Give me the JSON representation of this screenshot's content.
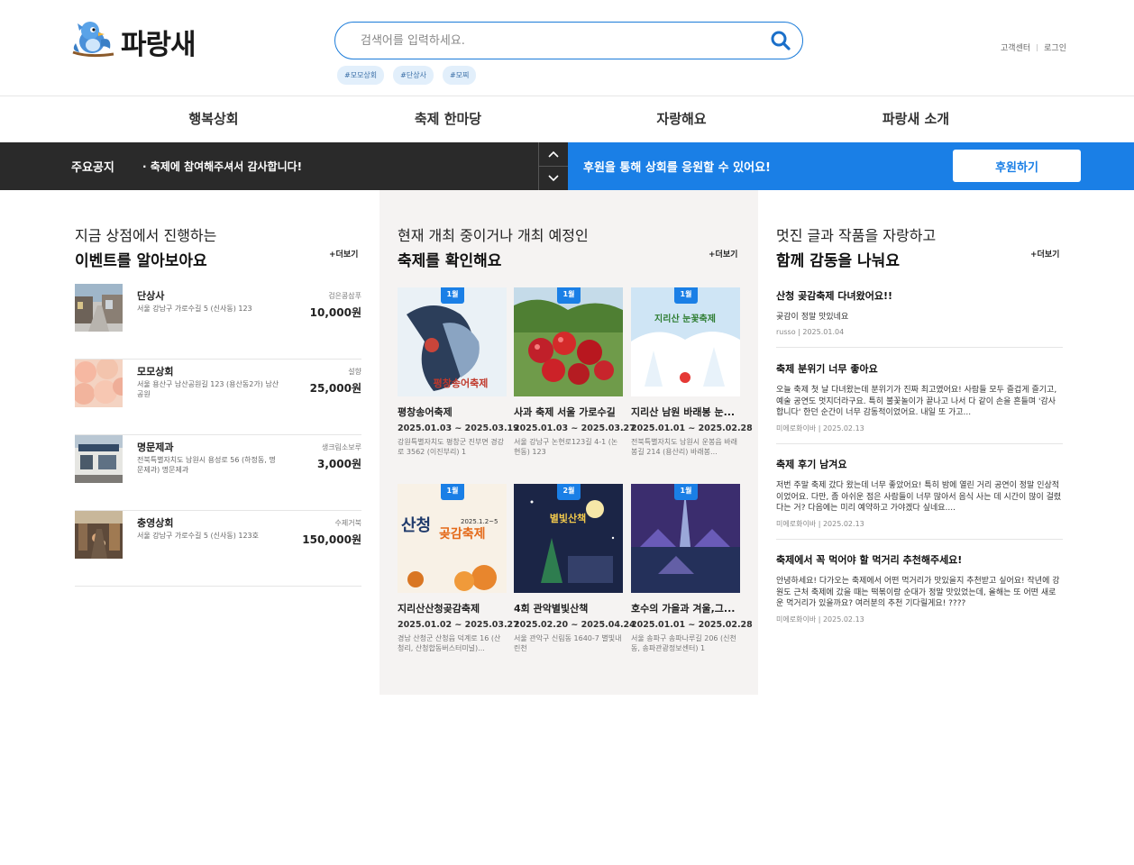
{
  "brand": {
    "name": "파랑새"
  },
  "search": {
    "placeholder": "검색어를 입력하세요.",
    "tags": [
      "#모모상회",
      "#단상사",
      "#모찌"
    ]
  },
  "util": {
    "support": "고객센터",
    "login": "로그인"
  },
  "nav": [
    "행복상회",
    "축제 한마당",
    "자랑해요",
    "파랑새 소개"
  ],
  "notice": {
    "label": "주요공지",
    "text": "· 축제에 참여해주셔서 감사합니다!"
  },
  "support_banner": {
    "text": "후원을 통해 상회를 응원할 수 있어요!",
    "button": "후원하기"
  },
  "events": {
    "line1": "지금 상점에서 진행하는",
    "line2": "이벤트를 알아보아요",
    "more": "+더보기",
    "items": [
      {
        "name": "단상사",
        "address": "서울 강남구 가로수길 5 (신사동) 123",
        "category": "검은콩삼푸",
        "price": "10,000원"
      },
      {
        "name": "모모상회",
        "address": "서울 용산구 남산공원길 123 (용산동2가) 남산공원",
        "category": "설향",
        "price": "25,000원"
      },
      {
        "name": "명문제과",
        "address": "전북특별자치도 남원시 용성로 56 (하정동, 명문제과) 명문제과",
        "category": "생크림소보루",
        "price": "3,000원"
      },
      {
        "name": "충영상회",
        "address": "서울 강남구 가로수길 5 (신사동) 123호",
        "category": "수제거북",
        "price": "150,000원"
      }
    ]
  },
  "festivals": {
    "line1": "현재 개최 중이거나 개최 예정인",
    "line2": "축제를 확인해요",
    "more": "+더보기",
    "items": [
      {
        "month": "1월",
        "title": "평창송어축제",
        "date": "2025.01.03 ~ 2025.03.19",
        "location": "강원특별자치도 평창군 진부면 경강로 3562 (이진부리) 1"
      },
      {
        "month": "1월",
        "title": "사과 축제 서울 가로수길",
        "date": "2025.01.03 ~ 2025.03.27",
        "location": "서울 강남구 논현로123길 4-1 (논현동) 123"
      },
      {
        "month": "1월",
        "title": "지리산 남원 바래봉 눈...",
        "date": "2025.01.01 ~ 2025.02.28",
        "location": "전북특별자치도 남원시 운봉읍 바래봉길 214 (용산리) 바래봉..."
      },
      {
        "month": "1월",
        "title": "지리산산청곶감축제",
        "date": "2025.01.02 ~ 2025.03.27",
        "location": "경남 산청군 산청읍 덕계로 16 (산청리, 산청합동버스터미널)..."
      },
      {
        "month": "2월",
        "title": "4회 관악별빛산책",
        "date": "2025.02.20 ~ 2025.04.24",
        "location": "서울 관악구 신림동 1640-7 별빛내린천"
      },
      {
        "month": "1월",
        "title": "호수의 가을과 겨울,그...",
        "date": "2025.01.01 ~ 2025.02.28",
        "location": "서울 송파구 송파나루길 206 (신천동, 송파관광정보센터) 1"
      }
    ],
    "poster_texts": {
      "p1": "평창송어축제",
      "p3": "지리산 눈꽃축제",
      "p4a": "산청",
      "p4b": "곶감축제",
      "p4c": "2025.1.2~5",
      "p5": "별빛산책"
    }
  },
  "posts": {
    "line1": "멋진 글과 작품을 자랑하고",
    "line2": "함께 감동을 나눠요",
    "more": "+더보기",
    "items": [
      {
        "title": "산청 곶감축제 다녀왔어요!!",
        "body": "곶감이 정말 맛있네요",
        "meta": "russo | 2025.01.04"
      },
      {
        "title": "축제 분위기 너무 좋아요",
        "body": "오늘 축제 첫 날 다녀왔는데 분위기가 진짜 최고였어요! 사람들 모두 즐겁게 즐기고, 예술 공연도 멋지더라구요. 특히 불꽃놀이가 끝나고 나서 다 같이 손을 흔들며 '감사합니다' 한던 순간이 너무 감동적이었어요. 내일 또 가고...",
        "meta": "미에로화이바 | 2025.02.13"
      },
      {
        "title": "축제 후기 남겨요",
        "body": "저번 주말 축제 갔다 왔는데 너무 좋았어요! 특히 밤에 열린 거리 공연이 정말 인상적이었어요. 다만, 좀 아쉬운 점은 사람들이 너무 많아서 음식 사는 데 시간이 많이 걸렸다는 거? 다음에는 미리 예약하고 가야겠다 싶네요....",
        "meta": "미에로화이바 | 2025.02.13"
      },
      {
        "title": "축제에서 꼭 먹어야 할 먹거리 추천해주세요!",
        "body": "안녕하세요! 다가오는 축제에서 어떤 먹거리가 맛있을지 추천받고 싶어요! 작년에 강원도 근처 축제에 갔을 때는 떡볶이랑 순대가 정말 맛있었는데, 올해는 또 어떤 새로운 먹거리가 있을까요? 여러분의 추천 기다릴게요! ????",
        "meta": "미에로화이바 | 2025.02.13"
      }
    ]
  }
}
